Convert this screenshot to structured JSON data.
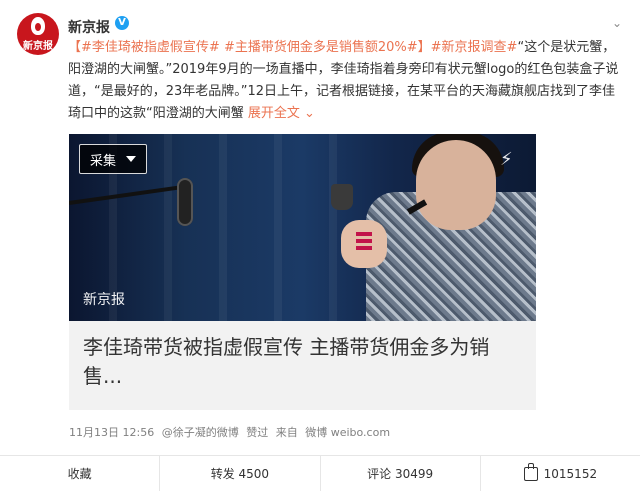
{
  "post": {
    "author": "新京报",
    "verified_icon": "verified-icon",
    "avatar_logo_text": "新京报",
    "more_icon": "chevron-down-icon",
    "text_bracket_open": "【",
    "tag1": "#李佳琦被指虚假宣传#",
    "tag2": "#主播带货佣金多是销售额20%#",
    "text_bracket_close": "】",
    "tag3": "#新京报调查#",
    "body": "“这个是状元蟹，阳澄湖的大闸蟹。”2019年9月的一场直播中，李佳琦指着身旁印有状元蟹logo的红色包装盒子说道，“是最好的，23年老品牌。”12日上午，记者根据链接，在某平台的天海藏旗舰店找到了李佳琦口中的这款“阳澄湖的大闸蟹",
    "expand": "展开全文",
    "expand_icon": "chevron-down-icon"
  },
  "card": {
    "badge": "采集",
    "badge_icon": "caret-down-icon",
    "corner_icon": "lightning-icon",
    "watermark": "新京报",
    "title": "李佳琦带货被指虚假宣传 主播带货佣金多为销售..."
  },
  "meta": {
    "time": "11月13日 12:56",
    "via_user": "@徐子凝的微博",
    "liked": "赞过",
    "source_prefix": "来自",
    "source": "微博 weibo.com"
  },
  "actions": [
    {
      "label": "收藏"
    },
    {
      "label": "转发 4500"
    },
    {
      "label": "评论 30499"
    },
    {
      "label": "1015152",
      "icon": "thumb-up-icon"
    }
  ]
}
